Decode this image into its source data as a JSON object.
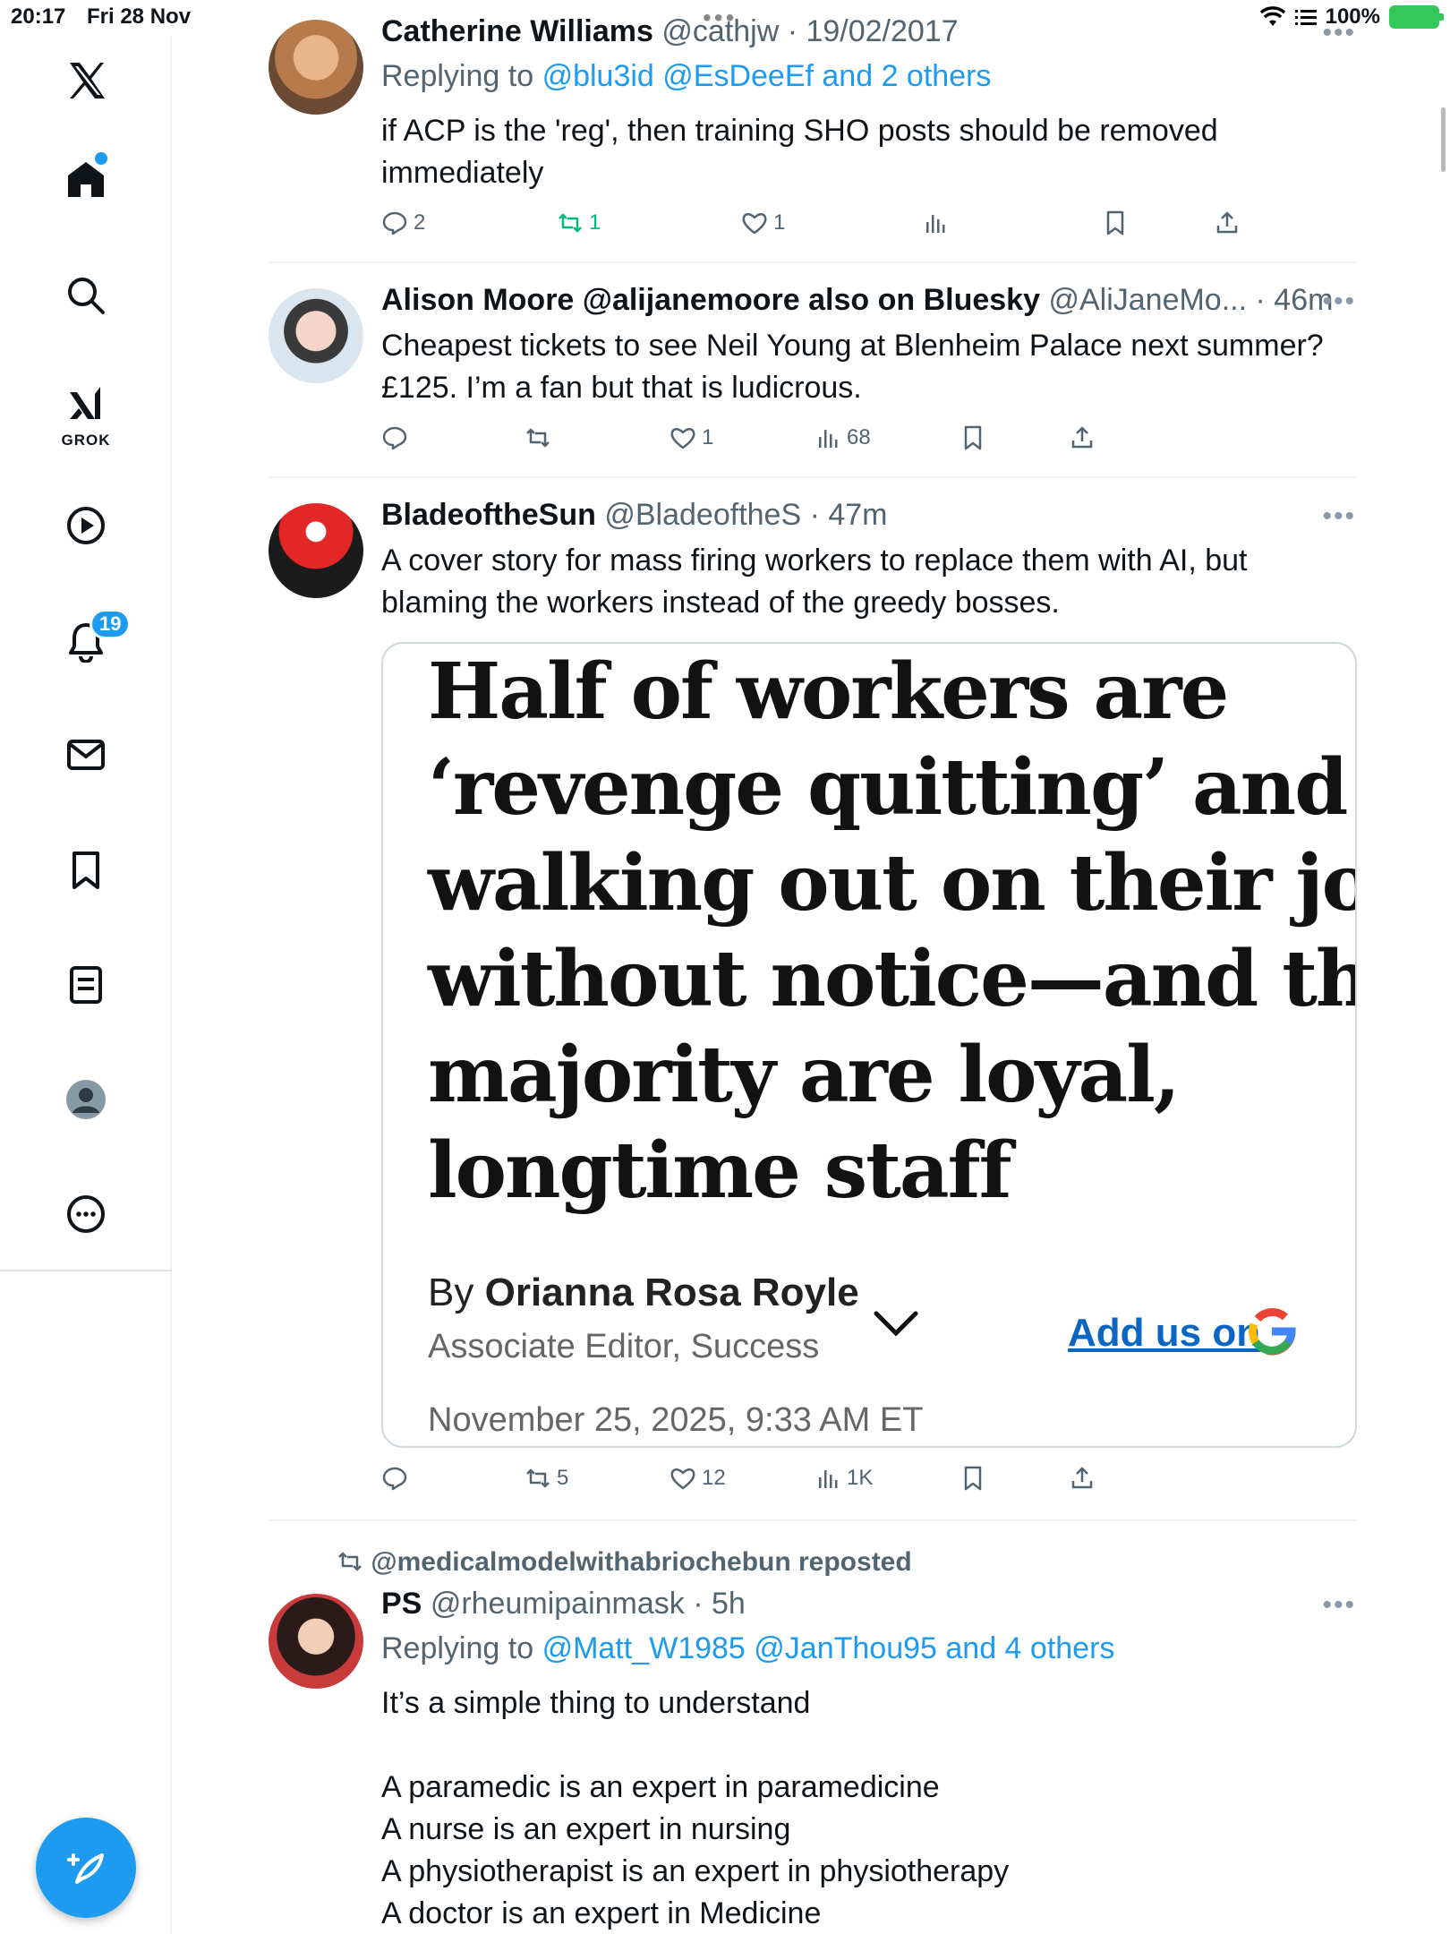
{
  "status": {
    "time": "20:17",
    "date": "Fri 28 Nov",
    "battery": "100%"
  },
  "sidebar": {
    "items": [
      {
        "name": "home",
        "icon": "home-icon"
      },
      {
        "name": "search",
        "icon": "search-icon"
      },
      {
        "name": "grok",
        "icon": "grok-icon",
        "label": "GROK"
      },
      {
        "name": "video",
        "icon": "play-icon"
      },
      {
        "name": "notifications",
        "icon": "bell-icon",
        "badge": "19"
      },
      {
        "name": "messages",
        "icon": "mail-icon"
      },
      {
        "name": "bookmarks",
        "icon": "bookmark-icon"
      },
      {
        "name": "lists",
        "icon": "list-icon"
      },
      {
        "name": "profile",
        "icon": "profile-icon"
      },
      {
        "name": "more",
        "icon": "more-icon"
      }
    ],
    "compose_icon": "compose-icon"
  },
  "tweets": [
    {
      "name": "Catherine Williams",
      "handle": "@cathjw",
      "time": "19/02/2017",
      "replying_prefix": "Replying to",
      "replying_to": "@blu3id @EsDeeEf and 2 others",
      "text": "if ACP is the 'reg', then training SHO posts should be removed immediately",
      "replies": "2",
      "reposts": "1",
      "likes": "1",
      "views": "",
      "reposted_highlight": true
    },
    {
      "name": "Alison Moore @alijanemoore also on Bluesky",
      "handle": "@AliJaneMo...",
      "time": "46m",
      "text": "Cheapest tickets to see Neil Young at Blenheim Palace next summer? £125. I’m a fan but that is ludicrous.",
      "replies": "",
      "reposts": "",
      "likes": "1",
      "views": "68"
    },
    {
      "name": "BladeoftheSun",
      "handle": "@BladeoftheS",
      "time": "47m",
      "text": "A cover story for mass firing workers to replace them with AI, but blaming the workers instead of the greedy bosses.",
      "card": {
        "headline_lines": [
          "Half of workers are",
          "‘revenge quitting’ and",
          "walking out on their jobs",
          "without notice—and the",
          "majority are loyal,",
          "longtime staff"
        ],
        "by": "By",
        "author": "Orianna Rosa Royle",
        "role": "Associate Editor, Success",
        "date": "November 25, 2025, 9:33 AM ET",
        "add_us": "Add us on"
      },
      "replies": "",
      "reposts": "5",
      "likes": "12",
      "views": "1K"
    },
    {
      "reposted_by": "@medicalmodelwithabriochebun reposted",
      "name": "PS",
      "handle": "@rheumipainmask",
      "time": "5h",
      "replying_prefix": "Replying to",
      "replying_to": "@Matt_W1985 @JanThou95 and 4 others",
      "text_lines": [
        "It’s a simple thing to understand",
        "",
        "A paramedic is an expert in paramedicine",
        "A nurse is an expert in nursing",
        "A physiotherapist is an expert in physiotherapy",
        "A doctor is an expert in Medicine"
      ]
    }
  ],
  "colors": {
    "accent": "#1d9bf0",
    "repost_green": "#00ba7c",
    "muted": "#536471"
  }
}
